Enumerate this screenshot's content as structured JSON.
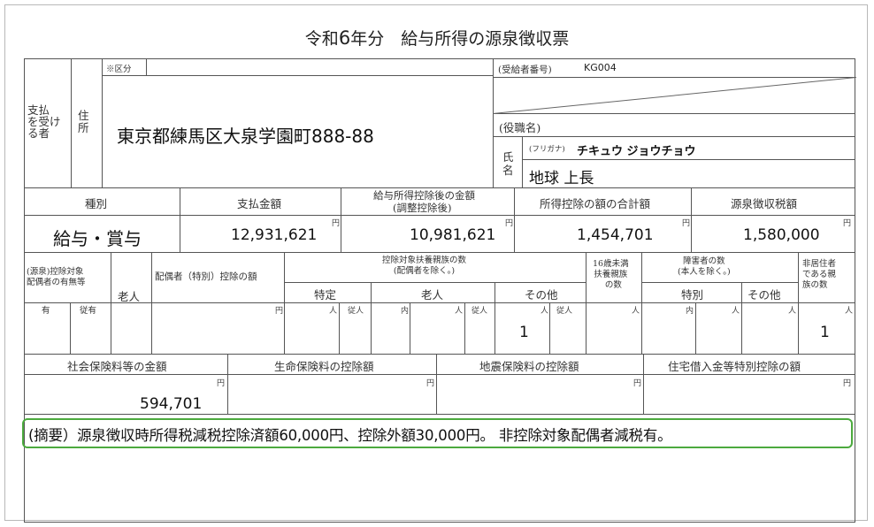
{
  "title": {
    "prefix": "令和",
    "year": "6",
    "suffix": "年分　給与所得の源泉徴収票"
  },
  "payee": {
    "label": "支払\nを受け\nる者",
    "address_label": "住\n所",
    "category_label": "※区分",
    "address": "東京都練馬区大泉学園町888-88",
    "recipient_number_label": "(受給者番号)",
    "recipient_number": "KG004",
    "position_label": "(役職名)",
    "name_label": "氏\n名",
    "furigana_label": "(フリガナ)",
    "furigana": "チキュウ ジョウチョウ",
    "name": "地球 上長"
  },
  "amounts": {
    "headers": [
      "種別",
      "支払金額",
      "給与所得控除後の金額",
      "(調整控除後)",
      "所得控除の額の合計額",
      "源泉徴収税額"
    ],
    "unit": "円",
    "type": "給与・賞与",
    "payment": "12,931,621",
    "after_deduction": "10,981,621",
    "total_deduction": "1,454,701",
    "withholding_tax": "1,580,000"
  },
  "dependents": {
    "spouse_label": [
      "(源泉)控除対象",
      "配偶者の有無等"
    ],
    "elderly": "老人",
    "spouse_deduction": "配偶者（特別）控除の額",
    "dep_header": [
      "控除対象扶養親族の数",
      "(配偶者を除く。)"
    ],
    "specific": "特定",
    "elderly2": "老人",
    "other": "その他",
    "under16": [
      "16歳未満",
      "扶養親族",
      "の数"
    ],
    "disabled": [
      "障害者の数",
      "(本人を除く。)"
    ],
    "special": "特別",
    "other2": "その他",
    "nonresident": [
      "非居住者",
      "である親",
      "族の数"
    ],
    "has": "有",
    "cohabiting": "従有",
    "yen": "円",
    "person": "人",
    "cohab_person": "従人",
    "inner": "内",
    "other_count": "1",
    "nonresident_count": "1"
  },
  "insurance": {
    "social": "社会保険料等の金額",
    "life": "生命保険料の控除額",
    "earthquake": "地震保険料の控除額",
    "housing": "住宅借入金等特別控除の額",
    "unit": "円",
    "social_amount": "594,701"
  },
  "summary": "(摘要）源泉徴収時所得税減税控除済額60,000円、控除外額30,000円。 非控除対象配偶者減税有。"
}
